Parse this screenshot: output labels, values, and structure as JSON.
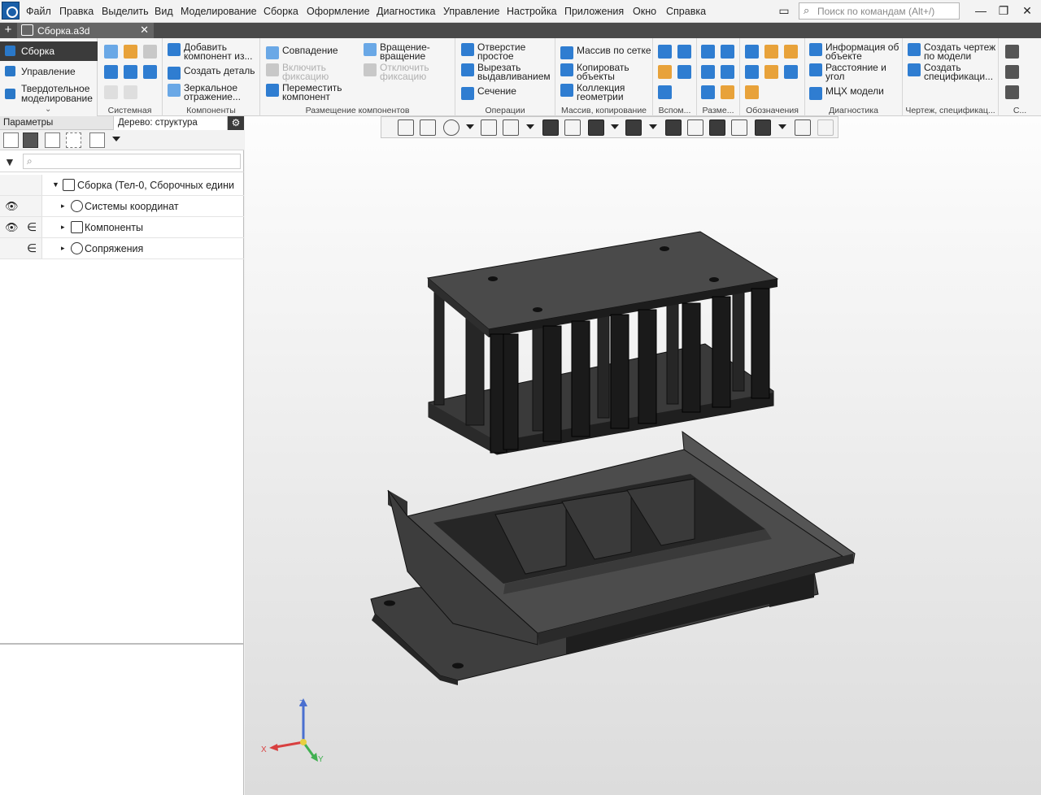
{
  "menu": {
    "items": [
      "Файл",
      "Правка",
      "Выделить",
      "Вид",
      "Моделирование",
      "Сборка",
      "Оформление",
      "Диагностика",
      "Управление",
      "Настройка",
      "Приложения",
      "Окно",
      "Справка"
    ],
    "search_placeholder": "Поиск по командам (Alt+/)"
  },
  "tabs": {
    "document": "Сборка.a3d"
  },
  "ribbon": {
    "modes": [
      "Сборка",
      "Управление",
      "Твердотельное моделирование"
    ],
    "groups": {
      "system": "Системная",
      "components": "Компоненты",
      "placement": "Размещение компонентов",
      "operations": "Операции",
      "array": "Массив, копирование",
      "aux": "Вспом...",
      "dims": "Разме...",
      "marks": "Обозначения",
      "diag": "Диагностика",
      "drawing": "Чертеж, спецификац...",
      "last": "С..."
    },
    "buttons": {
      "add_component": "Добавить компонент из...",
      "create_part": "Создать деталь",
      "mirror": "Зеркальное отражение...",
      "coincidence": "Совпадение",
      "rotation": "Вращение-вращение",
      "enable_fix": "Включить фиксацию",
      "disable_fix": "Отключить фиксацию",
      "move_component": "Переместить компонент",
      "hole": "Отверстие простое",
      "cut_extrude": "Вырезать выдавливанием",
      "section": "Сечение",
      "grid_array": "Массив по сетке",
      "copy_objects": "Копировать объекты",
      "geom_collection": "Коллекция геометрии",
      "object_info": "Информация об объекте",
      "distance_angle": "Расстояние и угол",
      "mass_props": "МЦХ модели",
      "create_drawing": "Создать чертеж по модели",
      "create_spec": "Создать спецификаци..."
    }
  },
  "panel": {
    "tab_params": "Параметры",
    "tab_tree": "Дерево: структура",
    "filter_placeholder": "",
    "tree": {
      "root": "Сборка (Тел-0, Сборочных едини",
      "coords": "Системы координат",
      "components": "Компоненты",
      "mates": "Сопряжения"
    }
  },
  "axes": {
    "x": "X",
    "y": "Y",
    "z": "Z"
  },
  "colors": {
    "accent": "#2f7dd1",
    "model": "#3d3d3d",
    "ribbon_active": "#3b3b3b"
  }
}
